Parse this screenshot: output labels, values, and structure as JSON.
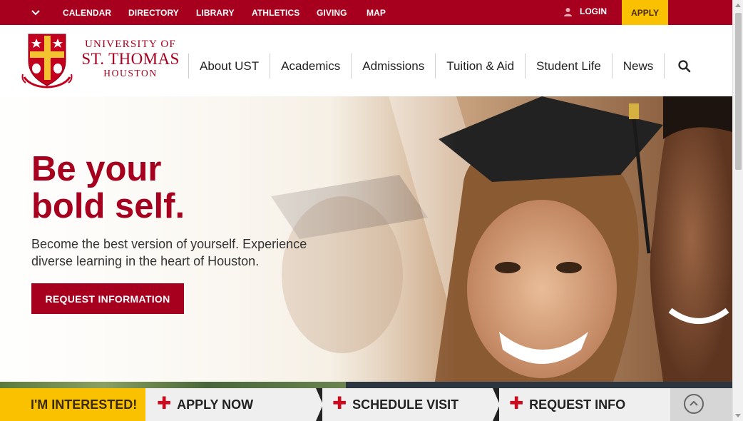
{
  "utility_nav": {
    "items": [
      "CALENDAR",
      "DIRECTORY",
      "LIBRARY",
      "ATHLETICS",
      "GIVING",
      "MAP"
    ],
    "login": "LOGIN",
    "apply": "APPLY",
    "toggle_icon": "chevron-down-icon",
    "login_icon": "user-icon"
  },
  "logo": {
    "line1": "UNIVERSITY OF",
    "line2": "ST. THOMAS",
    "line3": "HOUSTON",
    "crest_icon": "university-crest"
  },
  "main_nav": {
    "items": [
      "About UST",
      "Academics",
      "Admissions",
      "Tuition & Aid",
      "Student Life",
      "News"
    ],
    "search_icon": "search-icon"
  },
  "hero": {
    "headline_line1": "Be your",
    "headline_line2": "bold self.",
    "subtext": "Become the best version of yourself. Experience diverse learning in the heart of Houston.",
    "cta": "REQUEST INFORMATION"
  },
  "interest_bar": {
    "label": "I'M INTERESTED!",
    "actions": [
      "APPLY NOW",
      "SCHEDULE VISIT",
      "REQUEST INFO"
    ],
    "collapse_icon": "chevron-up-circle-icon"
  },
  "colors": {
    "brand_red": "#a6001e",
    "gold": "#f9c100"
  }
}
